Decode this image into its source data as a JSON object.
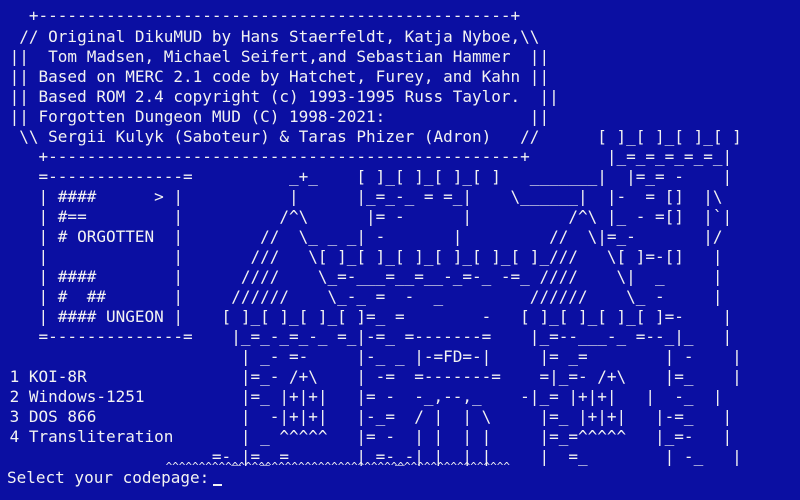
{
  "terminal": {
    "lines": [
      "   +-------------------------------------------------+",
      "  // Original DikuMUD by Hans Staerfeldt, Katja Nyboe,\\\\",
      " ||  Tom Madsen, Michael Seifert,and Sebastian Hammer  ||",
      " || Based on MERC 2.1 code by Hatchet, Furey, and Kahn ||",
      " || Based ROM 2.4 copyright (c) 1993-1995 Russ Taylor.  ||",
      " || Forgotten Dungeon MUD (C) 1998-2021:               ||",
      "  \\\\ Sergii Kulyk (Saboteur) & Taras Phizer (Adron)   //      [ ]_[ ]_[ ]_[ ]",
      "    +-------------------------------------------------+        |_=_=_=_=_=_|",
      "    =--------------=          _+_    [ ]_[ ]_[ ]_[ ]   _______|  |=_= -    |",
      "    | ####      > |           |      |_=_-_ = =_|    \\______|  |-  = []  |\\",
      "    | #==         |          /^\\      |= -      |          /^\\ |_ - =[]  |`|",
      "    | # ORGOTTEN  |        //  \\_ _ _| -       |         //  \\|=_-       |/",
      "    |             |       ///   \\[ ]_[ ]_[ ]_[ ]_[ ]_[ ]_///   \\[ ]=-[]   |",
      "    | ####        |      ////    \\_=-___=__=__-_=-_ -=_ ////    \\|  _     |",
      "    | #  ##       |     //////    \\_-_ =  -  _         //////    \\_ -     |",
      "    | #### UNGEON |    [ ]_[ ]_[ ]_[ ]=_ =        -   [ ]_[ ]_[ ]_[ ]=-    |",
      "    =--------------=    |_=_-_=_-_ =_|-=_ =-------=    |_=--___-_ =--_|_   |",
      "                         | _- =-     |-_ _ |-=FD=-|     |= _=        | -    |",
      "                         |=_- /+\\    | -=  =-------=    =|_=- /+\\    |=_    |",
      "                         |=_ |+|+|   |= -  -_,--,_    -|_= |+|+|   |  -_  |",
      "                         |  -|+|+|   |-_=  / |  | \\     |=_ |+|+|   |-=_   |",
      "                         | _ ^^^^^   |= -  | |  | |     |=_=^^^^^   |_=-   |",
      "                      =-_|=_ =       | =-_-| |  | |     |  =_        | -_   |",
      "                         ^^^^^^^^^^^^^^^^^^^^^^^^^^^^^^^^^^^^^^^^^^^^^^^^^^^^"
    ],
    "menu": [
      " 1 KOI-8R",
      " 2 Windows-1251",
      " 3 DOS 866",
      " 4 Transliteration"
    ],
    "prompt": "Select your codepage:"
  }
}
